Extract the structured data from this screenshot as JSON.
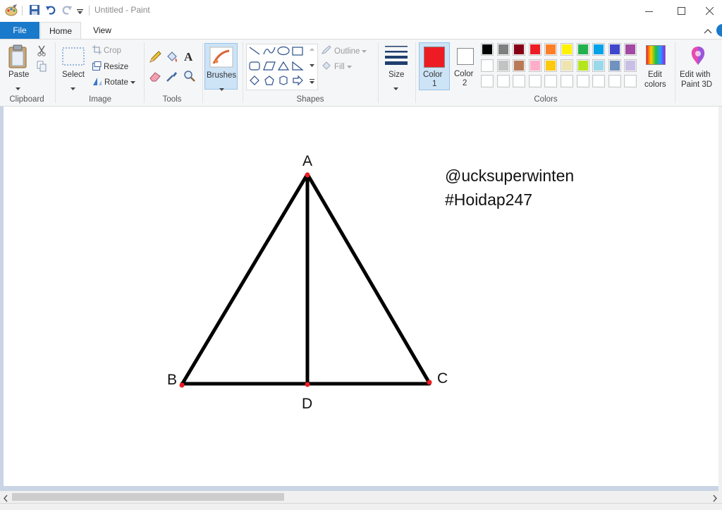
{
  "window": {
    "title": "Untitled - Paint"
  },
  "tabs": {
    "file": "File",
    "home": "Home",
    "view": "View"
  },
  "clipboard": {
    "paste": "Paste",
    "group": "Clipboard"
  },
  "image": {
    "select": "Select",
    "crop": "Crop",
    "resize": "Resize",
    "rotate": "Rotate",
    "group": "Image"
  },
  "tools": {
    "group": "Tools"
  },
  "brushes": {
    "label": "Brushes"
  },
  "shapes": {
    "outline": "Outline",
    "fill": "Fill",
    "group": "Shapes"
  },
  "size": {
    "label": "Size"
  },
  "colors": {
    "color1_label": "Color",
    "color1_num": "1",
    "color2_label": "Color",
    "color2_num": "2",
    "edit_line1": "Edit",
    "edit_line2": "colors",
    "paint3d_line1": "Edit with",
    "paint3d_line2": "Paint 3D",
    "group": "Colors",
    "color1_value": "#ed1c24",
    "color2_value": "#ffffff",
    "palette_row1": [
      "#000000",
      "#7f7f7f",
      "#880015",
      "#ed1c24",
      "#ff7f27",
      "#fff200",
      "#22b14c",
      "#00a2e8",
      "#3f48cc",
      "#a349a4"
    ],
    "palette_row2": [
      "#ffffff",
      "#c3c3c3",
      "#b97a57",
      "#ffaec9",
      "#ffc90e",
      "#efe4b0",
      "#b5e61d",
      "#99d9ea",
      "#7092be",
      "#c8bfe7"
    ],
    "palette_row3": [
      "#ffffff",
      "#ffffff",
      "#ffffff",
      "#ffffff",
      "#ffffff",
      "#ffffff",
      "#ffffff",
      "#ffffff",
      "#ffffff",
      "#ffffff"
    ]
  },
  "drawing": {
    "label_a": "A",
    "label_b": "B",
    "label_c": "C",
    "label_d": "D",
    "text_line1": "@ucksuperwinten",
    "text_line2": "#Hoidap247"
  }
}
